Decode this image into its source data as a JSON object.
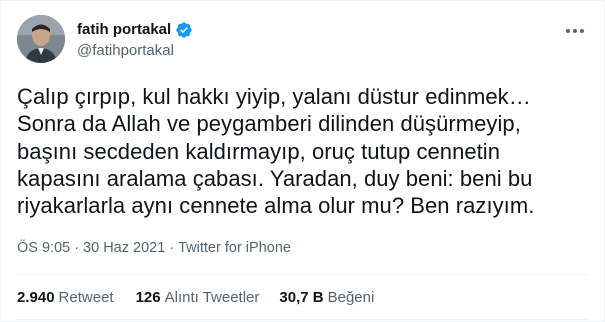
{
  "colors": {
    "verified_badge": "#1d9bf0",
    "text_primary": "#0f1419",
    "text_secondary": "#536471"
  },
  "author": {
    "display_name": "fatih portakal",
    "handle": "@fatihportakal",
    "verified_icon": "verified-badge-icon",
    "avatar_icon": "user-avatar"
  },
  "menu": {
    "icon": "more-options-icon"
  },
  "tweet": {
    "text": "Çalıp çırpıp, kul hakkı yiyip, yalanı düstur edinmek…\nSonra da Allah ve peygamberi dilinden düşürmeyip,\nbaşını secdeden kaldırmayıp, oruç tutup cennetin\nkapasını aralama çabası. Yaradan, duy beni: beni bu\nriyakarlarla aynı cennete alma olur mu? Ben razıyım."
  },
  "meta": {
    "time": "ÖS 9:05",
    "separator": "·",
    "date": "30 Haz 2021",
    "source": "Twitter for iPhone"
  },
  "stats": {
    "retweets": {
      "count": "2.940",
      "label": "Retweet"
    },
    "quotes": {
      "count": "126",
      "label": "Alıntı Tweetler"
    },
    "likes": {
      "count": "30,7 B",
      "label": "Beğeni"
    }
  }
}
